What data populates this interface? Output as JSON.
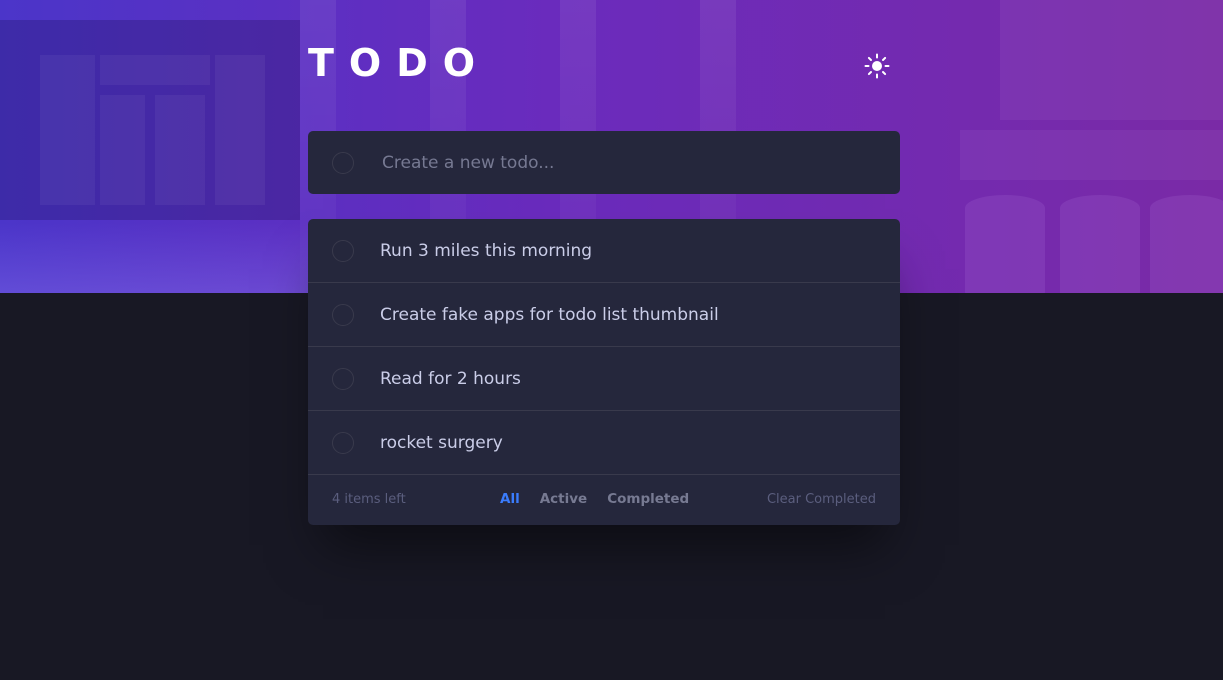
{
  "header": {
    "title": "TODO",
    "theme_icon": "sun-icon"
  },
  "new_todo": {
    "placeholder": "Create a new todo..."
  },
  "todos": [
    {
      "text": "Run 3 miles this morning",
      "completed": false
    },
    {
      "text": "Create fake apps for todo list thumbnail",
      "completed": false
    },
    {
      "text": "Read for 2 hours",
      "completed": false
    },
    {
      "text": "rocket surgery",
      "completed": false
    }
  ],
  "footer": {
    "items_left": "4 items left",
    "filters": [
      "All",
      "Active",
      "Completed"
    ],
    "active_filter": "All",
    "clear_label": "Clear Completed"
  },
  "colors": {
    "accent": "#3a7cfd",
    "card_bg": "#25273c",
    "page_bg": "#181824",
    "text": "#cacde8"
  }
}
